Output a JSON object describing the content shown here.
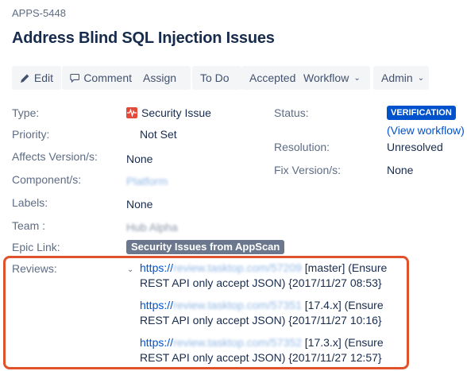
{
  "issue": {
    "key": "APPS-5448",
    "title": "Address Blind SQL Injection Issues"
  },
  "toolbar": {
    "edit": "Edit",
    "comment": "Comment",
    "assign": "Assign",
    "todo": "To Do",
    "accepted": "Accepted",
    "workflow": "Workflow",
    "admin": "Admin"
  },
  "details": {
    "type_label": "Type:",
    "type_value": "Security Issue",
    "priority_label": "Priority:",
    "priority_value": "Not Set",
    "affects_label": "Affects Version/s:",
    "affects_value": "None",
    "component_label": "Component/s:",
    "component_value": "Platform",
    "labels_label": "Labels:",
    "labels_value": "None",
    "team_label": "Team :",
    "team_value": "Hub Alpha",
    "epic_label": "Epic Link:",
    "epic_value": "Security Issues from AppScan",
    "reviews_label": "Reviews:"
  },
  "status": {
    "status_label": "Status:",
    "status_value": "VERIFICATION",
    "view_workflow": "(View workflow)",
    "resolution_label": "Resolution:",
    "resolution_value": "Unresolved",
    "fix_label": "Fix Version/s:",
    "fix_value": "None"
  },
  "reviews": [
    {
      "prefix": "https://",
      "host": "review.tasktop.com/57209",
      "line1_rest": " [master] (Ensure",
      "line2": "REST API only accept JSON) {2017/11/27 08:53}"
    },
    {
      "prefix": "https://",
      "host": "review.tasktop.com/57351",
      "line1_rest": " [17.4.x] (Ensure",
      "line2": "REST API only accept JSON) {2017/11/27 10:16}"
    },
    {
      "prefix": "https://",
      "host": "review.tasktop.com/57352",
      "line1_rest": " [17.3.x] (Ensure",
      "line2": "REST API only accept JSON) {2017/11/27 12:57}"
    }
  ],
  "colors": {
    "accent": "#0052cc",
    "security": "#e5493a",
    "highlight": "#e0522b",
    "lozenge": "#6b778c"
  },
  "icons": [
    "pencil-icon",
    "comment-icon",
    "chevron-down-icon",
    "security-issue-icon"
  ]
}
